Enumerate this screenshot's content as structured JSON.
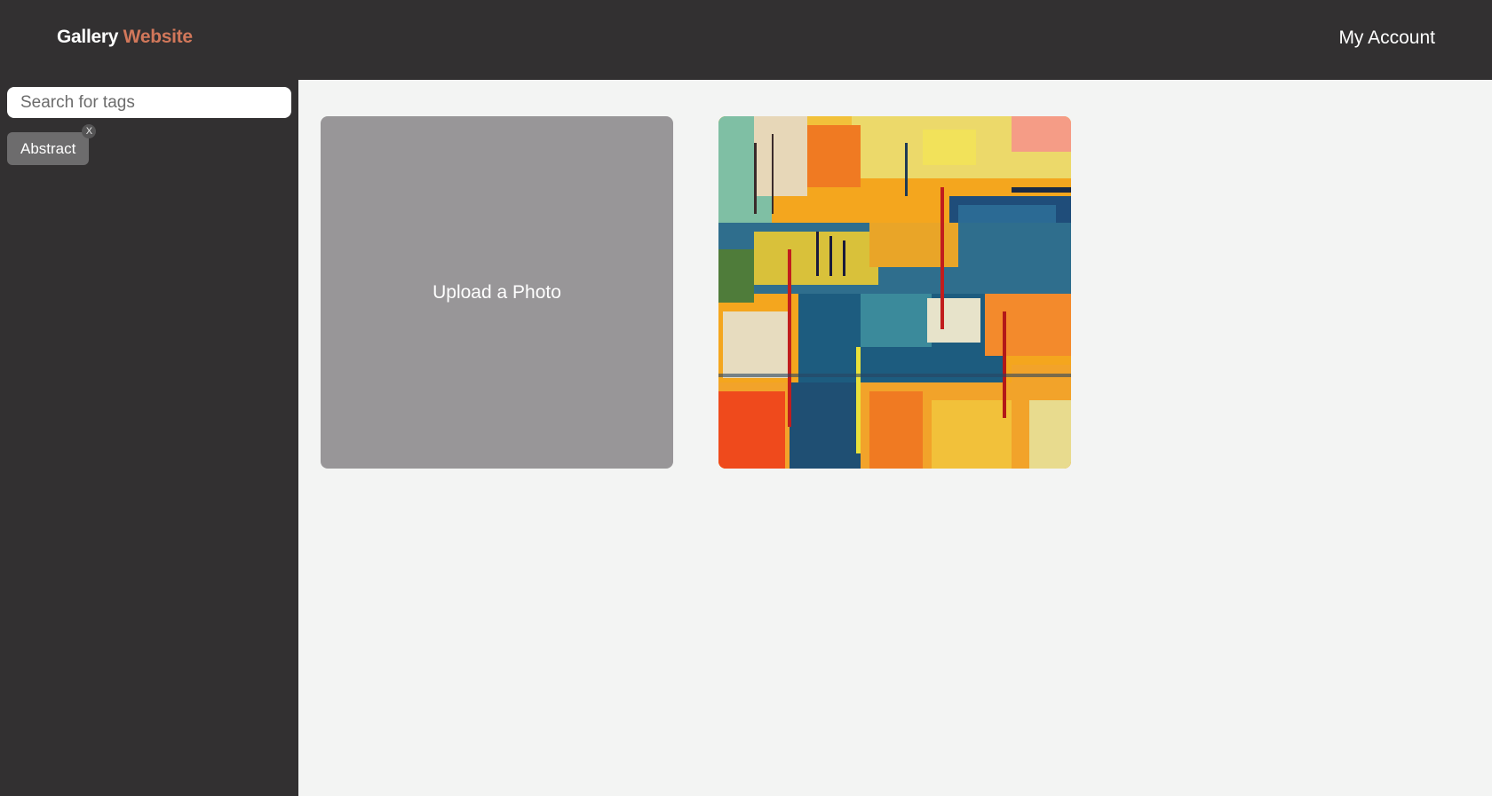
{
  "header": {
    "brand_part1": "Gallery",
    "brand_part2": "Website",
    "account_label": "My Account"
  },
  "sidebar": {
    "search_placeholder": "Search for tags",
    "search_value": "",
    "tags": [
      {
        "label": "Abstract",
        "remove_label": "X"
      }
    ]
  },
  "gallery": {
    "upload_label": "Upload a Photo",
    "photos": [
      {
        "icon": "abstract-painting-image"
      }
    ]
  },
  "colors": {
    "bar_bg": "#323031",
    "brand_accent": "#d1775a",
    "main_bg": "#f3f4f3",
    "upload_card_bg": "#989698",
    "tag_bg": "#6d6c6d"
  }
}
